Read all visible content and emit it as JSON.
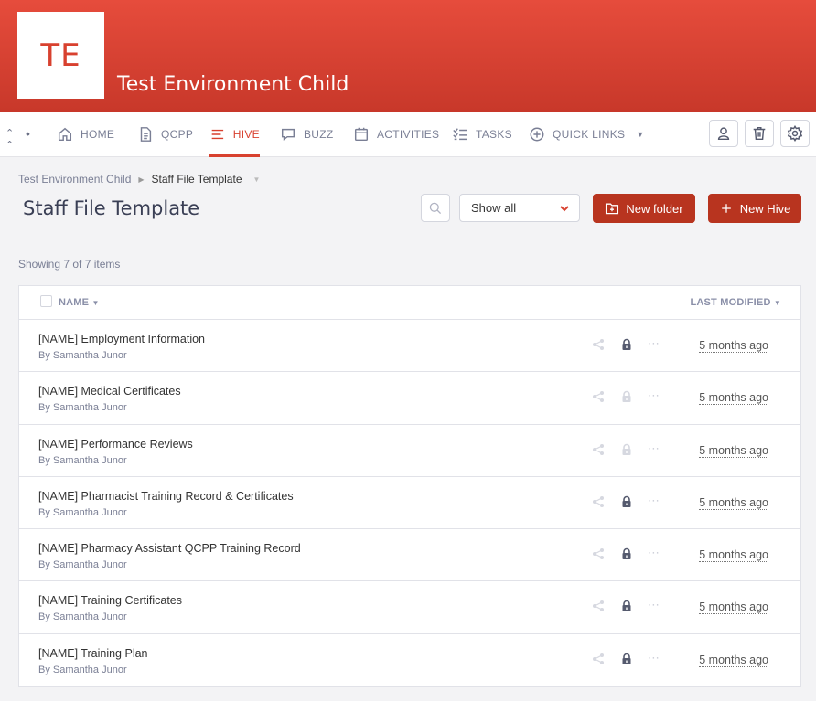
{
  "header": {
    "logo_initials": "TE",
    "site_title": "Test Environment Child"
  },
  "nav": {
    "items": [
      {
        "label": "HOME",
        "icon": "home-icon"
      },
      {
        "label": "QCPP",
        "icon": "document-icon"
      },
      {
        "label": "HIVE",
        "icon": "menu-lines-icon",
        "active": true
      },
      {
        "label": "BUZZ",
        "icon": "chat-icon"
      },
      {
        "label": "ACTIVITIES",
        "icon": "calendar-icon"
      },
      {
        "label": "TASKS",
        "icon": "checklist-icon"
      },
      {
        "label": "QUICK LINKS",
        "icon": "plus-circle-icon"
      }
    ],
    "right_buttons": [
      "user-icon",
      "trash-icon",
      "gear-icon"
    ]
  },
  "breadcrumb": {
    "parent": "Test Environment Child",
    "current": "Staff File Template"
  },
  "page_title": "Staff File Template",
  "toolbar": {
    "filter_value": "Show all",
    "new_folder_label": "New folder",
    "new_hive_label": "New Hive"
  },
  "showing_text": "Showing 7 of 7 items",
  "table": {
    "headers": {
      "name": "NAME",
      "last_modified": "LAST MODIFIED"
    },
    "rows": [
      {
        "title": "[NAME] Employment Information",
        "author": "By Samantha Junor",
        "modified": "5 months ago",
        "locked": true
      },
      {
        "title": "[NAME] Medical Certificates",
        "author": "By Samantha Junor",
        "modified": "5 months ago",
        "locked": false
      },
      {
        "title": "[NAME] Performance Reviews",
        "author": "By Samantha Junor",
        "modified": "5 months ago",
        "locked": false
      },
      {
        "title": "[NAME] Pharmacist Training Record & Certificates",
        "author": "By Samantha Junor",
        "modified": "5 months ago",
        "locked": true
      },
      {
        "title": "[NAME] Pharmacy Assistant QCPP Training Record",
        "author": "By Samantha Junor",
        "modified": "5 months ago",
        "locked": true
      },
      {
        "title": "[NAME] Training Certificates",
        "author": "By Samantha Junor",
        "modified": "5 months ago",
        "locked": true
      },
      {
        "title": "[NAME] Training Plan",
        "author": "By Samantha Junor",
        "modified": "5 months ago",
        "locked": true
      }
    ]
  },
  "colors": {
    "brand": "#d8412f",
    "button": "#b8341f",
    "lock_dark": "#555a6e",
    "lock_light": "#d6d8e0"
  }
}
